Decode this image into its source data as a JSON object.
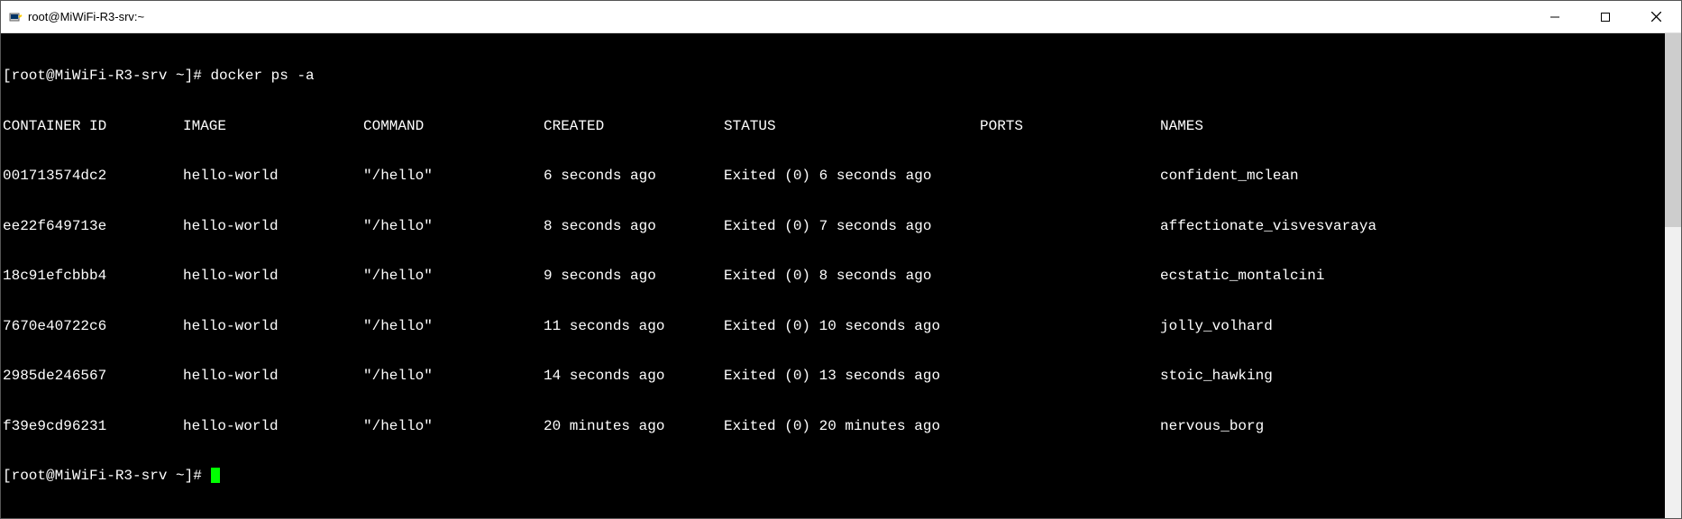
{
  "window": {
    "title": "root@MiWiFi-R3-srv:~"
  },
  "terminal": {
    "prompt": "[root@MiWiFi-R3-srv ~]# ",
    "command": "docker ps -a",
    "headers": {
      "container_id": "CONTAINER ID",
      "image": "IMAGE",
      "command": "COMMAND",
      "created": "CREATED",
      "status": "STATUS",
      "ports": "PORTS",
      "names": "NAMES"
    },
    "rows": [
      {
        "container_id": "001713574dc2",
        "image": "hello-world",
        "command": "\"/hello\"",
        "created": "6 seconds ago",
        "status": "Exited (0) 6 seconds ago",
        "ports": "",
        "names": "confident_mclean"
      },
      {
        "container_id": "ee22f649713e",
        "image": "hello-world",
        "command": "\"/hello\"",
        "created": "8 seconds ago",
        "status": "Exited (0) 7 seconds ago",
        "ports": "",
        "names": "affectionate_visvesvaraya"
      },
      {
        "container_id": "18c91efcbbb4",
        "image": "hello-world",
        "command": "\"/hello\"",
        "created": "9 seconds ago",
        "status": "Exited (0) 8 seconds ago",
        "ports": "",
        "names": "ecstatic_montalcini"
      },
      {
        "container_id": "7670e40722c6",
        "image": "hello-world",
        "command": "\"/hello\"",
        "created": "11 seconds ago",
        "status": "Exited (0) 10 seconds ago",
        "ports": "",
        "names": "jolly_volhard"
      },
      {
        "container_id": "2985de246567",
        "image": "hello-world",
        "command": "\"/hello\"",
        "created": "14 seconds ago",
        "status": "Exited (0) 13 seconds ago",
        "ports": "",
        "names": "stoic_hawking"
      },
      {
        "container_id": "f39e9cd96231",
        "image": "hello-world",
        "command": "\"/hello\"",
        "created": "20 minutes ago",
        "status": "Exited (0) 20 minutes ago",
        "ports": "",
        "names": "nervous_borg"
      }
    ],
    "prompt2": "[root@MiWiFi-R3-srv ~]# "
  }
}
